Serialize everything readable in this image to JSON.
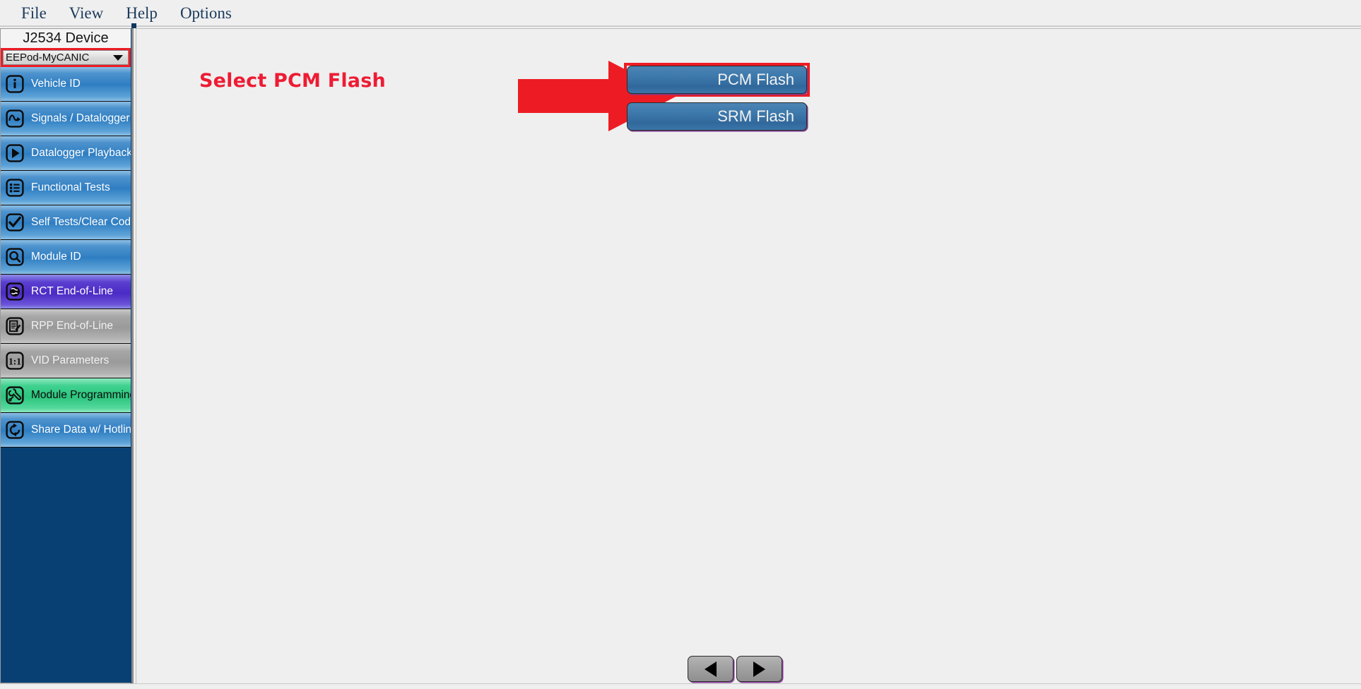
{
  "menu": {
    "items": [
      {
        "label": "File",
        "name": "menu-file"
      },
      {
        "label": "View",
        "name": "menu-view"
      },
      {
        "label": "Help",
        "name": "menu-help"
      },
      {
        "label": "Options",
        "name": "menu-options"
      }
    ]
  },
  "sidebar": {
    "device_header": "J2534 Device",
    "device_select": {
      "value": "EEPod-MyCANIC",
      "options": [
        "EEPod-MyCANIC"
      ]
    },
    "items": [
      {
        "label": "Vehicle ID",
        "icon": "info-icon",
        "state": "blue"
      },
      {
        "label": "Signals / Datalogger",
        "icon": "waveform-icon",
        "state": "blue"
      },
      {
        "label": "Datalogger Playback",
        "icon": "play-icon",
        "state": "blue"
      },
      {
        "label": "Functional Tests",
        "icon": "list-icon",
        "state": "blue"
      },
      {
        "label": "Self Tests/Clear Codes",
        "icon": "checkmark-icon",
        "state": "blue"
      },
      {
        "label": "Module ID",
        "icon": "magnifier-icon",
        "state": "blue"
      },
      {
        "label": "RCT End-of-Line",
        "icon": "globe-icon",
        "state": "purple"
      },
      {
        "label": "RPP End-of-Line",
        "icon": "document-pencil-icon",
        "state": "grey"
      },
      {
        "label": "VID Parameters",
        "icon": "one-to-one-icon",
        "state": "grey"
      },
      {
        "label": "Module Programming",
        "icon": "wrench-icon",
        "state": "green"
      },
      {
        "label": "Share Data w/ Hotline",
        "icon": "sync-icon",
        "state": "blue"
      }
    ]
  },
  "main": {
    "hint_text": "Select PCM Flash",
    "annotation": {
      "arrow": "right-arrow-annotation",
      "arrow_color": "#ed1c24",
      "highlight_color": "#ed1c24"
    },
    "buttons": [
      {
        "label": "PCM Flash",
        "highlighted": true
      },
      {
        "label": "SRM Flash",
        "highlighted": false
      }
    ]
  },
  "footer": {
    "prev_label": "◀",
    "next_label": "▶"
  },
  "colors": {
    "accent_red": "#ed1c24",
    "sidebar_bg": "#084074",
    "button_blue": "#3d78ab",
    "selected_green": "#2cc57e",
    "selected_purple": "#4b2bc4"
  }
}
